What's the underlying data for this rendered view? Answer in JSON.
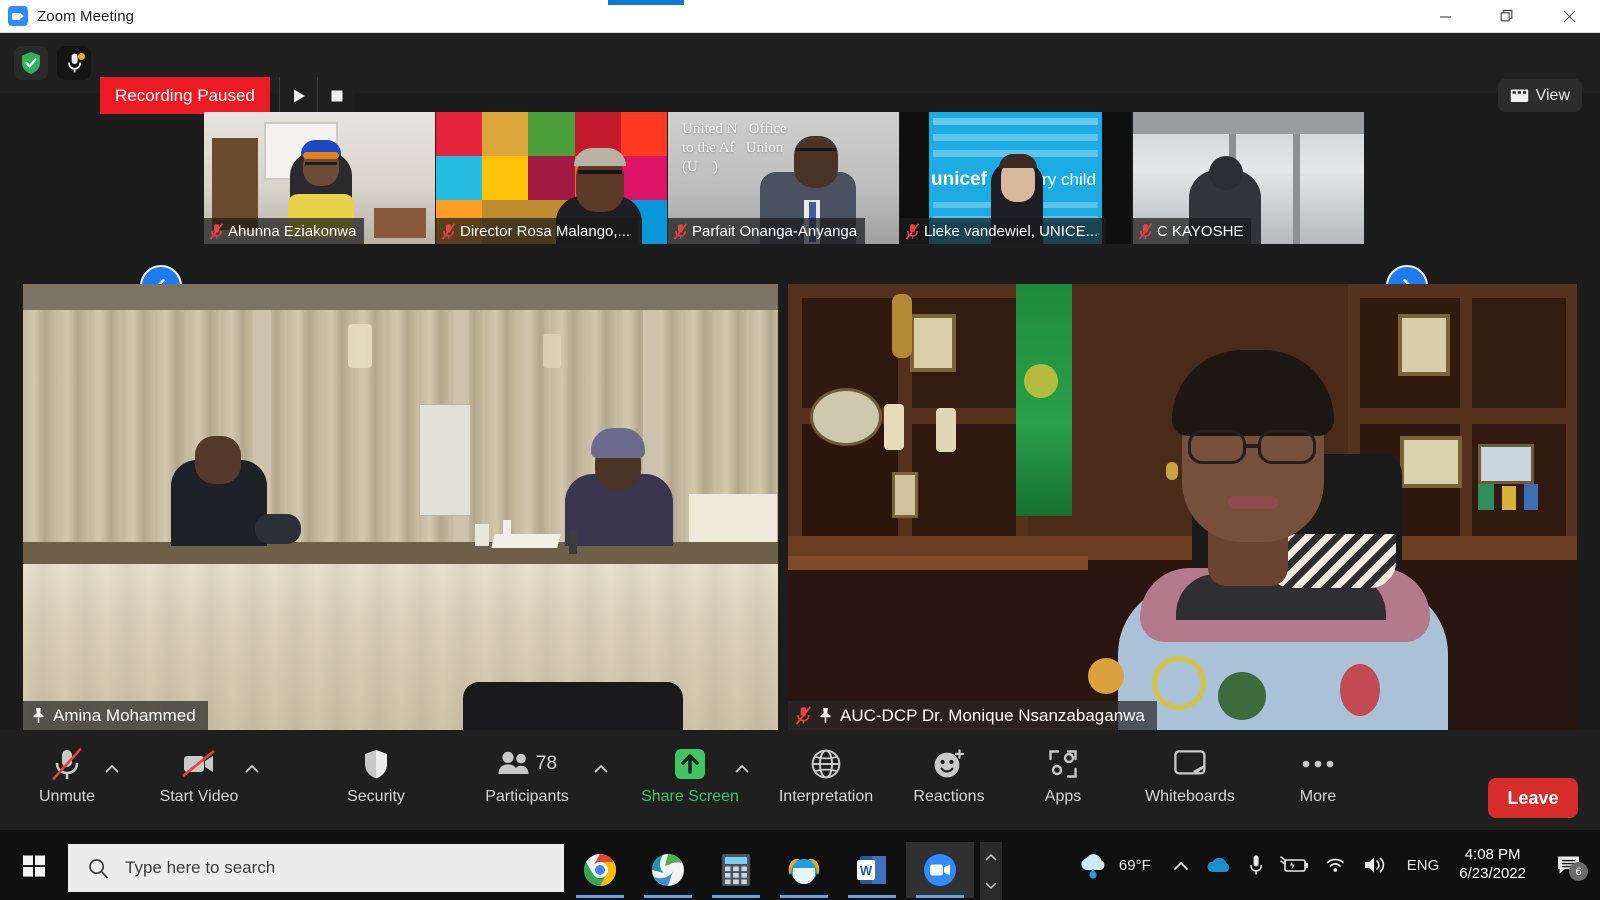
{
  "window": {
    "title": "Zoom Meeting",
    "app_icon": "zoom-camera-icon",
    "minimize_label": "Minimize",
    "restore_label": "Restore",
    "close_label": "Close"
  },
  "topbar": {
    "shield_icon": "security-shield-check-icon",
    "mic_icon": "microphone-icon",
    "recording_status": "Recording Paused",
    "resume_icon": "play-icon",
    "stop_icon": "stop-icon",
    "view_label": "View",
    "view_icon": "grid-view-icon",
    "recording_color": "#ea1b23"
  },
  "filmstrip": {
    "prev_label": "Previous participants",
    "next_label": "Next participants",
    "prev_icon": "chevron-left-icon",
    "next_icon": "chevron-right-icon",
    "thumbnails": [
      {
        "name": "Ahunna Eziakonwa",
        "muted": true,
        "scene": "office-yellow"
      },
      {
        "name": "Director Rosa Malango,...",
        "muted": true,
        "scene": "sdg-backdrop"
      },
      {
        "name": "Parfait Onanga-Anyanga",
        "muted": true,
        "scene": "un-office-banner"
      },
      {
        "name": "Lieke vandewiel, UNICE...",
        "muted": true,
        "scene": "unicef-blue"
      },
      {
        "name": "C KAYOSHE",
        "muted": true,
        "scene": "window-silhouette"
      }
    ]
  },
  "stage": {
    "videos": [
      {
        "name": "Amina Mohammed",
        "pinned": true,
        "muted": false,
        "scene": "conference-room"
      },
      {
        "name": "AUC-DCP Dr. Monique Nsanzabaganwa",
        "pinned": true,
        "muted": true,
        "scene": "office-bookshelf"
      }
    ]
  },
  "meeting_toolbar": {
    "controls": [
      {
        "label": "Unmute",
        "icon": "microphone-muted-icon",
        "has_caret": true,
        "highlight": false
      },
      {
        "label": "Start Video",
        "icon": "video-muted-icon",
        "has_caret": true,
        "highlight": false
      },
      {
        "label": "Security",
        "icon": "shield-icon",
        "has_caret": false,
        "highlight": false
      },
      {
        "label": "Participants",
        "icon": "participants-icon",
        "has_caret": true,
        "highlight": false,
        "badge": "78"
      },
      {
        "label": "Share Screen",
        "icon": "share-screen-icon",
        "has_caret": true,
        "highlight": true
      },
      {
        "label": "Interpretation",
        "icon": "globe-icon",
        "has_caret": false,
        "highlight": false
      },
      {
        "label": "Reactions",
        "icon": "reactions-smiley-icon",
        "has_caret": false,
        "highlight": false
      },
      {
        "label": "Apps",
        "icon": "apps-icon",
        "has_caret": false,
        "highlight": false
      },
      {
        "label": "Whiteboards",
        "icon": "whiteboard-icon",
        "has_caret": false,
        "highlight": false
      },
      {
        "label": "More",
        "icon": "more-ellipsis-icon",
        "has_caret": false,
        "highlight": false
      }
    ],
    "leave_label": "Leave",
    "share_color": "#41c463",
    "leave_color": "#d62c2c"
  },
  "taskbar": {
    "start_icon": "windows-start-icon",
    "search_icon": "search-icon",
    "search_placeholder": "Type here to search",
    "apps": [
      {
        "icon": "chrome-icon",
        "active": false
      },
      {
        "icon": "globe-browser-icon",
        "active": false
      },
      {
        "icon": "calculator-icon",
        "active": false
      },
      {
        "icon": "internet-explorer-icon",
        "active": false
      },
      {
        "icon": "word-icon",
        "active": false
      },
      {
        "icon": "zoom-icon",
        "active": true
      }
    ],
    "scroll_up_icon": "chevron-up-icon",
    "scroll_down_icon": "chevron-down-icon",
    "tray": {
      "weather_icon": "rain-cloud-icon",
      "temperature": "69°F",
      "overflow_icon": "chevron-up-icon",
      "onedrive_icon": "onedrive-icon",
      "mic_icon": "microphone-icon",
      "battery_icon": "battery-charging-icon",
      "wifi_icon": "wifi-icon",
      "volume_icon": "speaker-icon",
      "language": "ENG",
      "time": "4:08 PM",
      "date": "6/23/2022",
      "notification_icon": "notifications-icon",
      "notification_count": "6"
    }
  }
}
